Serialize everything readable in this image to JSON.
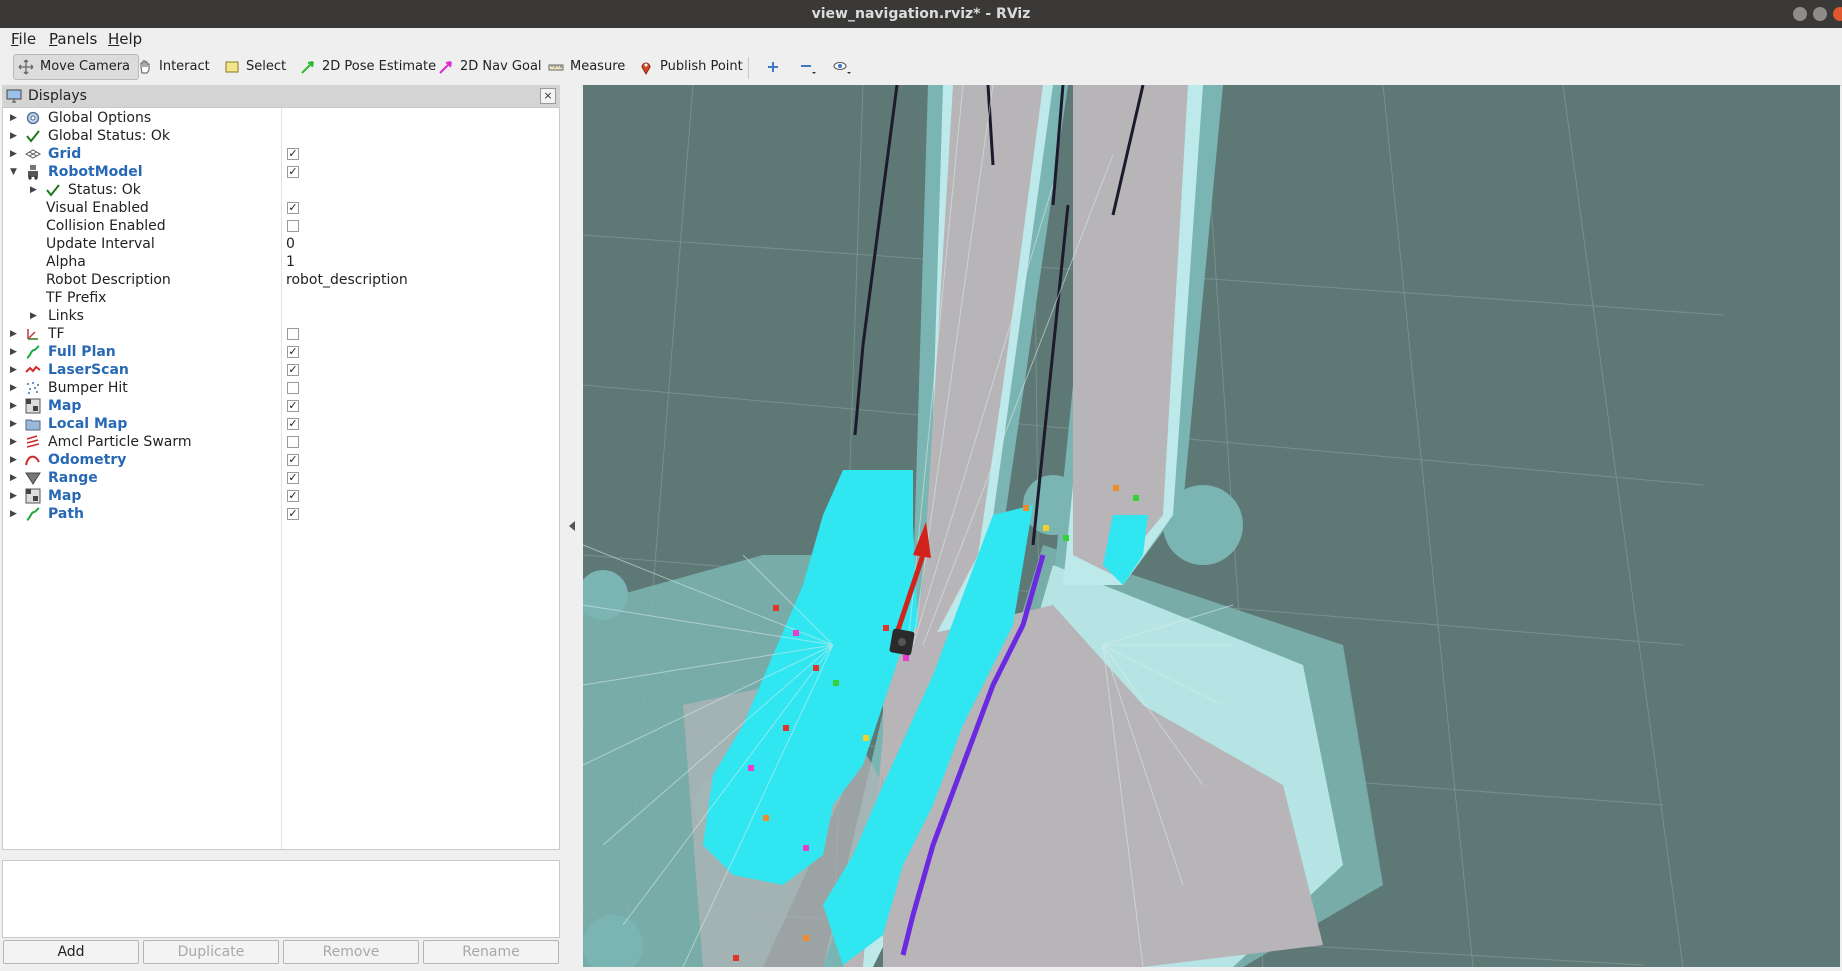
{
  "window": {
    "title": "view_navigation.rviz* - RViz"
  },
  "menu": [
    "File",
    "Panels",
    "Help"
  ],
  "toolbar": {
    "move_camera": "Move Camera",
    "interact": "Interact",
    "select": "Select",
    "pose_estimate": "2D Pose Estimate",
    "nav_goal": "2D Nav Goal",
    "measure": "Measure",
    "publish_point": "Publish Point"
  },
  "displays": {
    "title": "Displays",
    "close": "×",
    "rows": [
      {
        "label": "Global Options",
        "icon": "gear-icon",
        "checked": null,
        "value": ""
      },
      {
        "label": "Global Status: Ok",
        "icon": "check-icon",
        "checked": null,
        "value": ""
      },
      {
        "label": "Grid",
        "icon": "grid-icon",
        "checked": true,
        "value": ""
      },
      {
        "label": "RobotModel",
        "icon": "robot-icon",
        "checked": true,
        "value": ""
      },
      {
        "label": "Status: Ok",
        "icon": "check-icon",
        "checked": null,
        "value": ""
      },
      {
        "label": "Visual Enabled",
        "icon": "",
        "checked": true,
        "value": ""
      },
      {
        "label": "Collision Enabled",
        "icon": "",
        "checked": false,
        "value": ""
      },
      {
        "label": "Update Interval",
        "icon": "",
        "checked": null,
        "value": "0"
      },
      {
        "label": "Alpha",
        "icon": "",
        "checked": null,
        "value": "1"
      },
      {
        "label": "Robot Description",
        "icon": "",
        "checked": null,
        "value": "robot_description"
      },
      {
        "label": "TF Prefix",
        "icon": "",
        "checked": null,
        "value": ""
      },
      {
        "label": "Links",
        "icon": "",
        "checked": null,
        "value": ""
      },
      {
        "label": "TF",
        "icon": "tf-icon",
        "checked": false,
        "value": ""
      },
      {
        "label": "Full Plan",
        "icon": "path-icon",
        "checked": true,
        "value": ""
      },
      {
        "label": "LaserScan",
        "icon": "laser-icon",
        "checked": true,
        "value": ""
      },
      {
        "label": "Bumper Hit",
        "icon": "pointcloud-icon",
        "checked": false,
        "value": ""
      },
      {
        "label": "Map",
        "icon": "map-icon",
        "checked": true,
        "value": ""
      },
      {
        "label": "Local Map",
        "icon": "folder-icon",
        "checked": true,
        "value": ""
      },
      {
        "label": "Amcl Particle Swarm",
        "icon": "particles-icon",
        "checked": false,
        "value": ""
      },
      {
        "label": "Odometry",
        "icon": "odometry-icon",
        "checked": true,
        "value": ""
      },
      {
        "label": "Range",
        "icon": "range-icon",
        "checked": true,
        "value": ""
      },
      {
        "label": "Map",
        "icon": "map-icon",
        "checked": true,
        "value": ""
      },
      {
        "label": "Path",
        "icon": "path-icon",
        "checked": true,
        "value": ""
      }
    ]
  },
  "buttons": {
    "add": "Add",
    "duplicate": "Duplicate",
    "remove": "Remove",
    "rename": "Rename"
  }
}
